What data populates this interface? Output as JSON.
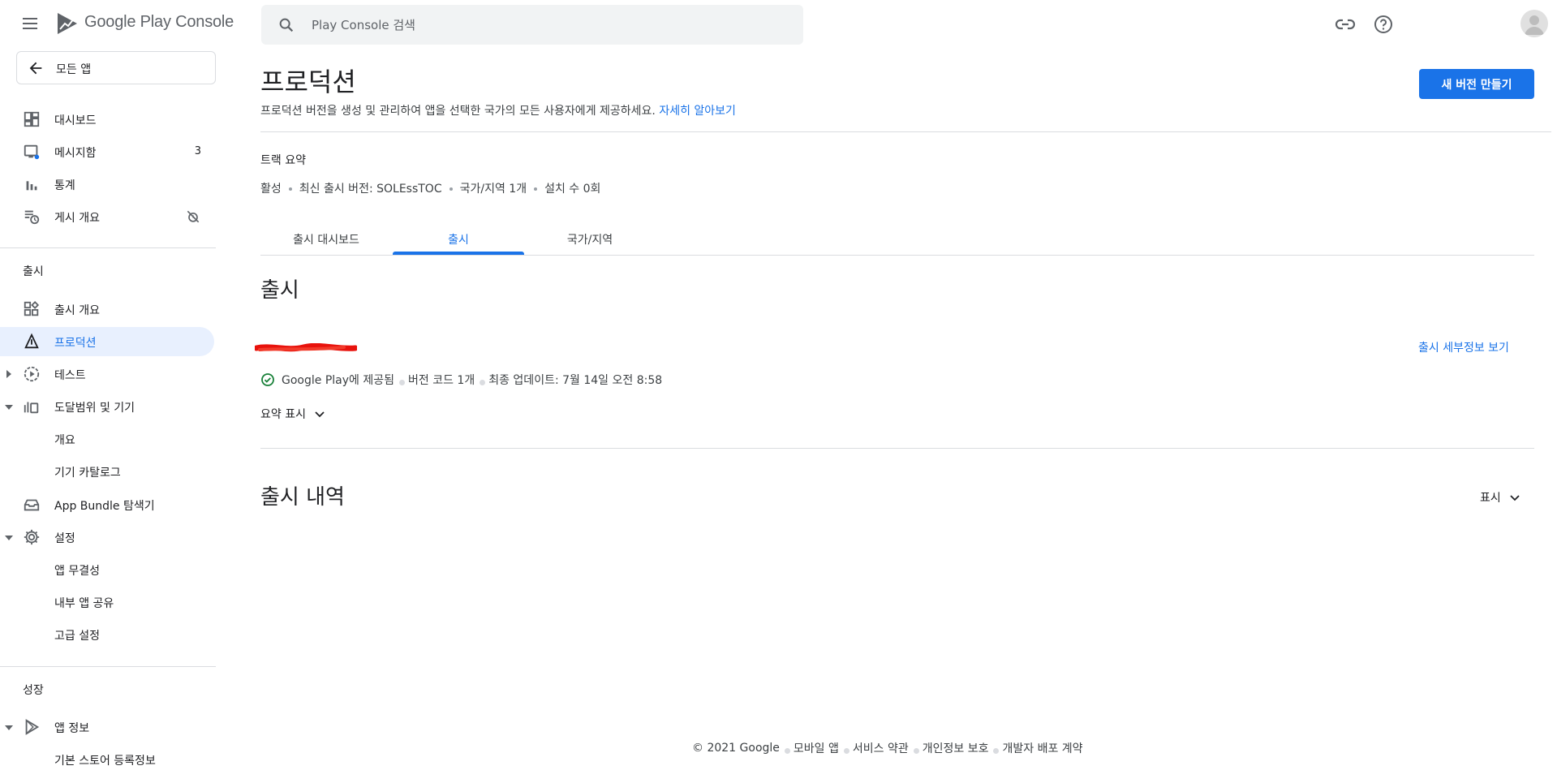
{
  "header": {
    "logo_text": "Google Play Console",
    "search_placeholder": "Play Console 검색"
  },
  "sidebar": {
    "back_label": "모든 앱",
    "items": [
      {
        "label": "대시보드"
      },
      {
        "label": "메시지함",
        "badge": "3"
      },
      {
        "label": "통계"
      },
      {
        "label": "게시 개요"
      }
    ],
    "release_section": "출시",
    "release_items": [
      {
        "label": "출시 개요"
      },
      {
        "label": "프로덕션"
      },
      {
        "label": "테스트"
      },
      {
        "label": "도달범위 및 기기"
      },
      {
        "label": "개요"
      },
      {
        "label": "기기 카탈로그"
      },
      {
        "label": "App Bundle 탐색기"
      },
      {
        "label": "설정"
      },
      {
        "label": "앱 무결성"
      },
      {
        "label": "내부 앱 공유"
      },
      {
        "label": "고급 설정"
      }
    ],
    "growth_section": "성장",
    "growth_items": [
      {
        "label": "앱 정보"
      },
      {
        "label": "기본 스토어 등록정보"
      }
    ],
    "active_item": "프로덕션"
  },
  "main": {
    "title": "프로덕션",
    "description": "프로덕션 버전을 생성 및 관리하여 앱을 선택한 국가의 모든 사용자에게 제공하세요.",
    "learn_more": "자세히 알아보기",
    "create_button": "새 버전 만들기",
    "track_summary": {
      "heading": "트랙 요약",
      "status": "활성",
      "latest_release": "최신 출시 버전: SOLEssTOC",
      "countries": "국가/지역 1개",
      "installs": "설치 수 0회"
    },
    "tabs": [
      {
        "label": "출시 대시보드"
      },
      {
        "label": "출시"
      },
      {
        "label": "국가/지역"
      }
    ],
    "active_tab": "출시",
    "release_heading": "출시",
    "release": {
      "view_details": "출시 세부정보 보기",
      "status": "Google Play에 제공됨",
      "version_codes": "버전 코드 1개",
      "last_updated": "최종 업데이트: 7월 14일 오전 8:58",
      "show_summary": "요약 표시"
    },
    "history_heading": "출시 내역",
    "history_toggle": "표시"
  },
  "footer": {
    "copyright": "© 2021 Google",
    "links": [
      "모바일 앱",
      "서비스 약관",
      "개인정보 보호",
      "개발자 배포 계약"
    ]
  },
  "colors": {
    "accent": "#1a73e8",
    "active_bg": "#e8f0fe",
    "success": "#188038",
    "redaction": "#e8120c"
  }
}
